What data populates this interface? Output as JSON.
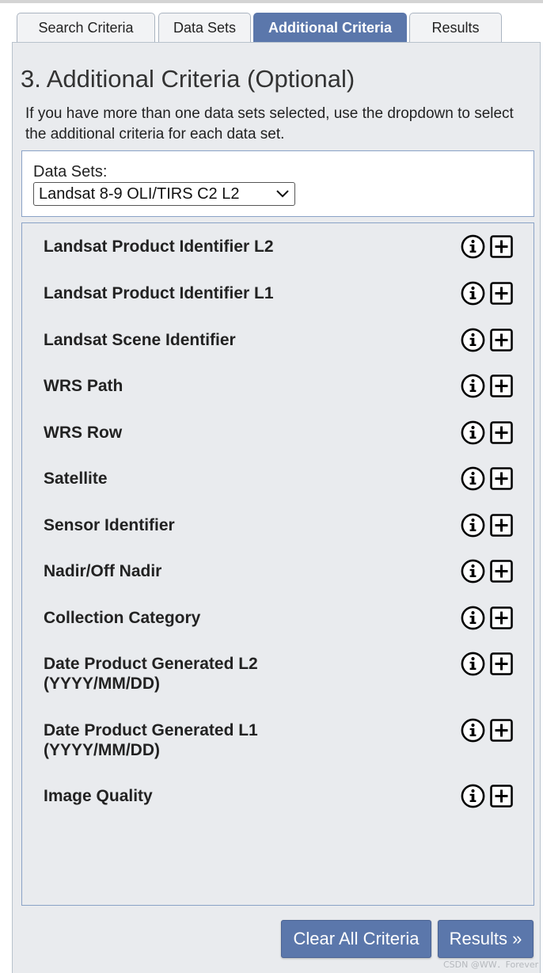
{
  "tabs": [
    {
      "label": "Search Criteria",
      "active": false
    },
    {
      "label": "Data Sets",
      "active": false
    },
    {
      "label": "Additional Criteria",
      "active": true
    },
    {
      "label": "Results",
      "active": false
    }
  ],
  "heading": "3. Additional Criteria (Optional)",
  "intro": "If you have more than one data sets selected, use the dropdown to select the additional criteria for each data set.",
  "datasets": {
    "label": "Data Sets:",
    "selected": "Landsat 8-9 OLI/TIRS C2 L2"
  },
  "criteria": [
    {
      "label": "Landsat Product Identifier L2",
      "name": "landsat-product-identifier-l2"
    },
    {
      "label": "Landsat Product Identifier L1",
      "name": "landsat-product-identifier-l1"
    },
    {
      "label": "Landsat Scene Identifier",
      "name": "landsat-scene-identifier"
    },
    {
      "label": "WRS Path",
      "name": "wrs-path"
    },
    {
      "label": "WRS Row",
      "name": "wrs-row"
    },
    {
      "label": "Satellite",
      "name": "satellite"
    },
    {
      "label": "Sensor Identifier",
      "name": "sensor-identifier"
    },
    {
      "label": "Nadir/Off Nadir",
      "name": "nadir-off-nadir"
    },
    {
      "label": "Collection Category",
      "name": "collection-category"
    },
    {
      "label": "Date Product Generated L2\n(YYYY/MM/DD)",
      "name": "date-product-generated-l2"
    },
    {
      "label": "Date Product Generated L1\n(YYYY/MM/DD)",
      "name": "date-product-generated-l1"
    },
    {
      "label": "Image Quality",
      "name": "image-quality"
    }
  ],
  "buttons": {
    "clear": "Clear All Criteria",
    "results": "Results »"
  },
  "watermark": "CSDN @WW．Forever",
  "colors": {
    "accent": "#5b77ab",
    "panel_bg": "#e9ebee",
    "border": "#8aa2c6"
  },
  "icons": [
    "info-circle-icon",
    "plus-square-icon",
    "chevron-down-icon"
  ]
}
